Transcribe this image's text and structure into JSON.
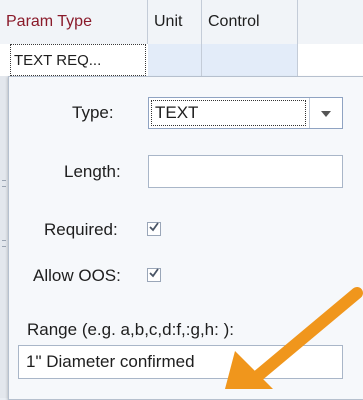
{
  "grid": {
    "columns": [
      "Param Type",
      "Unit",
      "Control"
    ],
    "row1_value": "TEXT REQ..."
  },
  "editor": {
    "type_label": "Type:",
    "type_value": "TEXT",
    "length_label": "Length:",
    "length_value": "",
    "required_label": "Required:",
    "required_checked": true,
    "allow_oos_label": "Allow OOS:",
    "allow_oos_checked": true,
    "range_label": "Range (e.g. a,b,c,d:f,:g,h: ):",
    "range_value": "1\" Diameter confirmed"
  },
  "colors": {
    "active_header_text": "#8a1a2a",
    "annotation_arrow": "#f0961c"
  },
  "icons": [
    "chevron-down-icon",
    "checkmark-icon",
    "arrow-annotation-icon"
  ]
}
